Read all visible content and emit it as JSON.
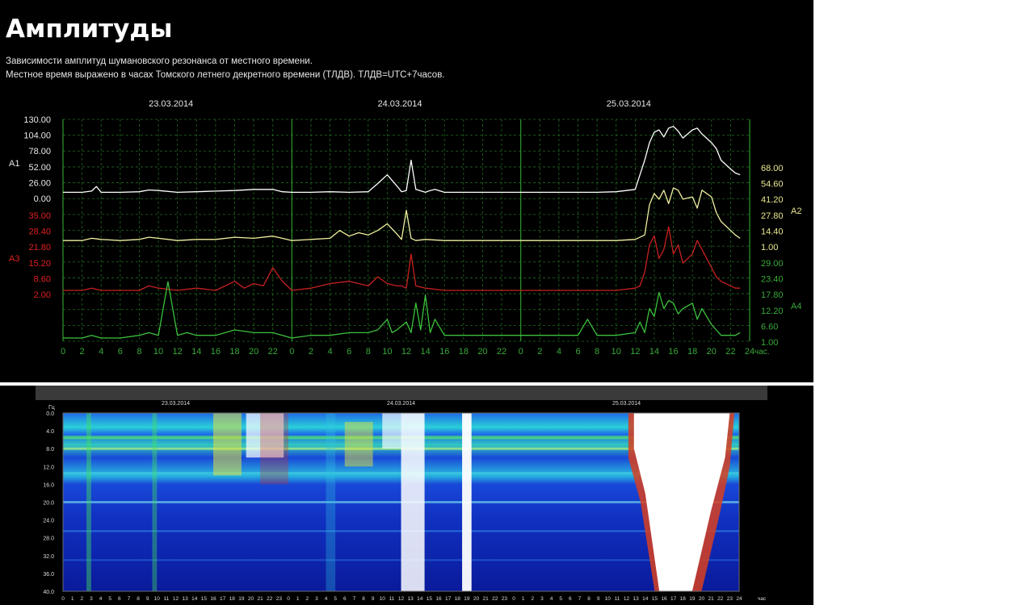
{
  "page": {
    "title": "Амплитуды",
    "description_line1": "Зависимости амплитуд шумановского резонанса от местного времени.",
    "description_line2": "Местное время выражено в часах Томского летнего декретного времени (ТЛДВ). ТЛДВ=UTC+7часов."
  },
  "colors": {
    "background": "#000000",
    "grid": "#1f6b1f",
    "text": "#e6e6e6",
    "axis_green": "#39a839",
    "a1": "#ffffff",
    "a2": "#f0f0a0",
    "a3": "#c82020",
    "a4": "#3cc03c",
    "label_red": "#e02020",
    "label_yellow": "#e8e890"
  },
  "chart_data": [
    {
      "type": "line",
      "dates": [
        "23.03.2014",
        "24.03.2014",
        "25.03.2014"
      ],
      "x_ticks": [
        "0",
        "2",
        "4",
        "6",
        "8",
        "10",
        "12",
        "14",
        "16",
        "18",
        "20",
        "22",
        "0",
        "2",
        "4",
        "6",
        "8",
        "10",
        "12",
        "14",
        "16",
        "18",
        "20",
        "22",
        "0",
        "2",
        "4",
        "6",
        "8",
        "10",
        "12",
        "14",
        "16",
        "18",
        "20",
        "22",
        "24"
      ],
      "x_unit": "час.",
      "xlim": [
        0,
        72
      ],
      "left_axes": [
        {
          "series": "A1",
          "ticks": [
            "130.00",
            "104.00",
            "78.00",
            "52.00",
            "26.00",
            "0.00"
          ]
        },
        {
          "series": "A3",
          "ticks": [
            "35.00",
            "28.40",
            "21.80",
            "15.20",
            "8.60",
            "2.00"
          ]
        }
      ],
      "right_axes": [
        {
          "series": "A2",
          "ticks": [
            "68.00",
            "54.60",
            "41.20",
            "27.80",
            "14.40",
            "1.00"
          ]
        },
        {
          "series": "A4",
          "ticks": [
            "29.00",
            "23.40",
            "17.80",
            "12.20",
            "6.60",
            "1.00"
          ]
        }
      ],
      "series": [
        {
          "name": "A1",
          "x": [
            0,
            2,
            3,
            3.5,
            4,
            6,
            8,
            9,
            10,
            12,
            14,
            16,
            18,
            20,
            22,
            23,
            24,
            26,
            28,
            30,
            32,
            33,
            34,
            35,
            35.5,
            36,
            36.5,
            37,
            38,
            38.5,
            39,
            40,
            42,
            44,
            46,
            48,
            50,
            52,
            54,
            56,
            58,
            60,
            61,
            61.5,
            62,
            62.5,
            63,
            63.5,
            64,
            64.5,
            65,
            66,
            66.5,
            67,
            68,
            68.5,
            69,
            70,
            70.5,
            71
          ],
          "y": [
            5,
            5,
            7,
            15,
            5,
            5,
            6,
            9,
            8,
            5,
            6,
            7,
            8,
            10,
            10,
            6,
            5,
            5,
            6,
            5,
            6,
            20,
            35,
            16,
            6,
            8,
            60,
            10,
            5,
            8,
            10,
            5,
            5,
            5,
            5,
            5,
            5,
            5,
            5,
            5,
            6,
            10,
            60,
            90,
            108,
            112,
            100,
            115,
            118,
            110,
            98,
            112,
            115,
            105,
            90,
            80,
            60,
            45,
            38,
            35
          ]
        },
        {
          "name": "A2",
          "x": [
            0,
            2,
            3,
            4,
            6,
            8,
            9,
            10,
            12,
            14,
            16,
            18,
            20,
            22,
            23,
            24,
            26,
            28,
            29,
            30,
            31,
            32,
            33,
            34,
            35,
            35.5,
            36,
            36.5,
            37,
            38,
            40,
            42,
            44,
            46,
            48,
            50,
            52,
            54,
            56,
            58,
            60,
            61,
            61.5,
            62,
            62.5,
            63,
            63.5,
            64,
            64.5,
            65,
            66,
            66.5,
            67,
            68,
            68.5,
            69,
            70,
            70.5,
            71
          ],
          "y": [
            3,
            3,
            5,
            4,
            3,
            4,
            6,
            5,
            3,
            4,
            4,
            6,
            5,
            7,
            5,
            3,
            4,
            5,
            12,
            7,
            10,
            8,
            12,
            18,
            9,
            4,
            30,
            5,
            3,
            4,
            3,
            3,
            3,
            3,
            3,
            3,
            3,
            3,
            3,
            3,
            4,
            8,
            35,
            45,
            40,
            48,
            36,
            50,
            48,
            40,
            42,
            32,
            48,
            42,
            28,
            20,
            12,
            8,
            5
          ]
        },
        {
          "name": "A3",
          "x": [
            0,
            2,
            3,
            4,
            6,
            8,
            9,
            10,
            12,
            14,
            16,
            17,
            18,
            19,
            20,
            21,
            22,
            23,
            24,
            26,
            28,
            30,
            32,
            33,
            34,
            35,
            35.5,
            36,
            36.5,
            37,
            38,
            40,
            42,
            44,
            46,
            48,
            50,
            52,
            54,
            56,
            58,
            60,
            60.5,
            61,
            61.5,
            62,
            62.5,
            63,
            63.5,
            64,
            64.5,
            65,
            66,
            66.5,
            67,
            68,
            68.5,
            69,
            70,
            70.5,
            71
          ],
          "y": [
            2,
            2,
            3,
            2,
            2,
            2,
            4,
            3,
            2,
            3,
            2,
            4,
            6,
            3,
            5,
            4,
            12,
            6,
            2,
            3,
            5,
            6,
            4,
            8,
            5,
            4,
            4,
            3,
            18,
            4,
            3,
            2,
            2,
            2,
            2,
            2,
            2,
            2,
            2,
            2,
            2,
            3,
            4,
            10,
            22,
            26,
            16,
            20,
            30,
            18,
            22,
            14,
            18,
            24,
            20,
            12,
            8,
            6,
            4,
            3,
            3
          ]
        },
        {
          "name": "A4",
          "x": [
            0,
            2,
            3,
            4,
            6,
            8,
            9,
            10,
            11,
            12,
            13,
            14,
            16,
            18,
            20,
            22,
            23,
            24,
            26,
            28,
            30,
            32,
            33,
            34,
            34.5,
            35,
            36,
            36.5,
            37,
            37.5,
            38,
            38.5,
            39,
            40,
            42,
            44,
            46,
            48,
            50,
            52,
            54,
            55,
            56,
            58,
            60,
            60.5,
            61,
            61.5,
            62,
            62.5,
            63,
            63.5,
            64,
            64.5,
            65,
            66,
            66.5,
            67,
            68,
            68.5,
            69,
            70,
            70.5,
            71
          ],
          "y": [
            1,
            1,
            2,
            1,
            1,
            2,
            3,
            2,
            22,
            2,
            3,
            2,
            2,
            4,
            3,
            3,
            2,
            1,
            2,
            2,
            3,
            3,
            4,
            8,
            3,
            4,
            7,
            3,
            14,
            4,
            17,
            3,
            8,
            2,
            2,
            2,
            2,
            2,
            2,
            2,
            2,
            8,
            2,
            2,
            3,
            7,
            3,
            12,
            9,
            18,
            12,
            15,
            14,
            10,
            12,
            14,
            8,
            12,
            6,
            4,
            2,
            2,
            2,
            3
          ]
        }
      ]
    },
    {
      "type": "heatmap",
      "dates": [
        "23.03.2014",
        "24.03.2014",
        "25.03.2014"
      ],
      "y_label": "Гц",
      "y_ticks": [
        "0.0",
        "4.0",
        "8.0",
        "12.0",
        "16.0",
        "20.0",
        "24.0",
        "28.0",
        "32.0",
        "36.0",
        "40.0"
      ],
      "x_ticks": [
        "0",
        "1",
        "2",
        "3",
        "4",
        "5",
        "6",
        "7",
        "8",
        "9",
        "10",
        "11",
        "12",
        "13",
        "14",
        "15",
        "16",
        "17",
        "18",
        "19",
        "20",
        "21",
        "22",
        "23",
        "0",
        "1",
        "2",
        "3",
        "4",
        "5",
        "6",
        "7",
        "8",
        "9",
        "10",
        "11",
        "12",
        "13",
        "14",
        "15",
        "16",
        "17",
        "18",
        "19",
        "20",
        "21",
        "22",
        "23",
        "0",
        "1",
        "2",
        "3",
        "4",
        "5",
        "6",
        "7",
        "8",
        "9",
        "10",
        "11",
        "12",
        "13",
        "14",
        "15",
        "16",
        "17",
        "18",
        "19",
        "20",
        "21",
        "22",
        "23",
        "24"
      ],
      "x_unit": "час",
      "ylim": [
        0,
        40
      ],
      "xlim": [
        0,
        72
      ],
      "colormap": [
        "#0a1a9a",
        "#1a5ae0",
        "#24c8e0",
        "#40e060",
        "#e0e040",
        "#d03020",
        "#ffffff"
      ]
    }
  ]
}
